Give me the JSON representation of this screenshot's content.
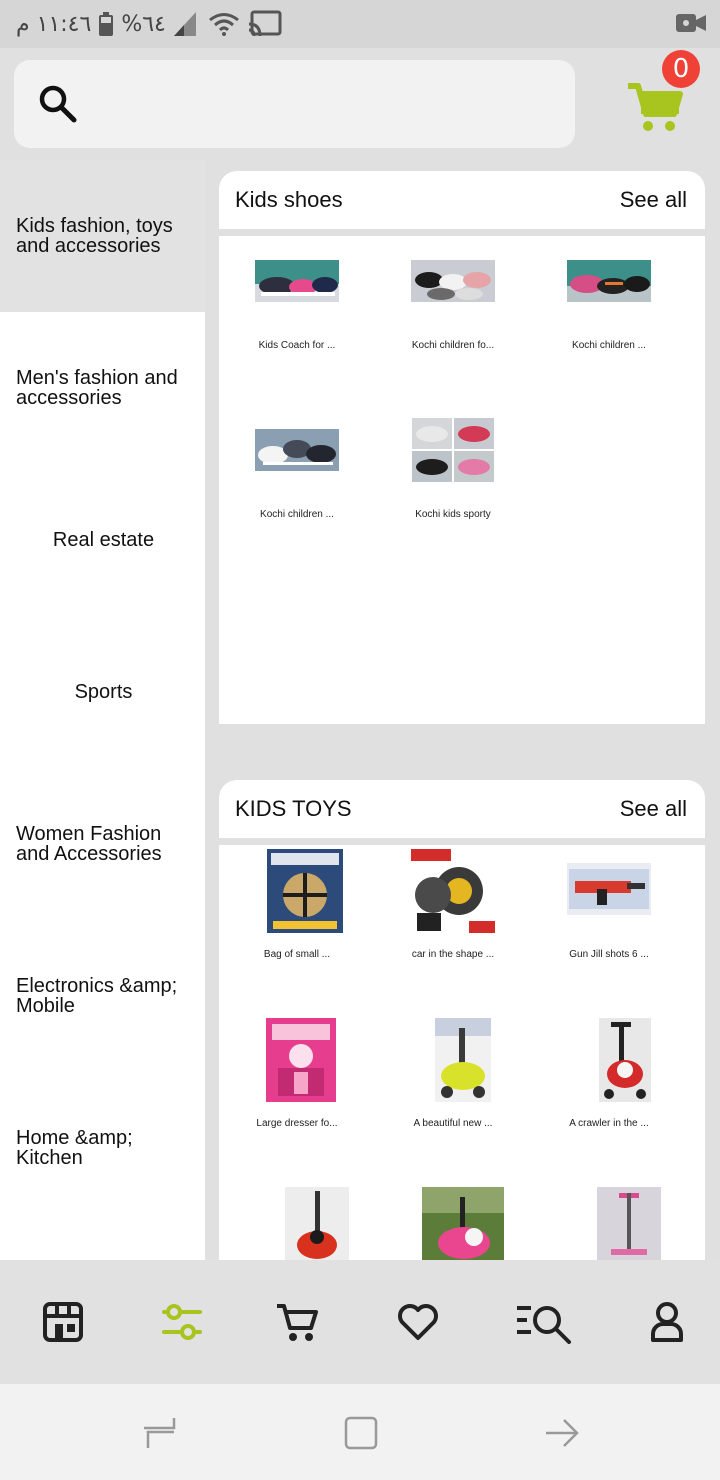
{
  "status_bar": {
    "time": "١١:٤٦ م",
    "battery": "%٦٤",
    "icons": [
      "battery-icon",
      "signal-icon",
      "wifi-icon",
      "cast-icon",
      "video-camera-icon"
    ]
  },
  "header": {
    "search_placeholder": "",
    "cart_count": "0",
    "accent_color": "#a8c41e",
    "badge_color": "#ef4136"
  },
  "sidebar": {
    "categories": [
      {
        "label": "Kids fashion, toys and accessories",
        "active": true
      },
      {
        "label": "Men's fashion and accessories"
      },
      {
        "label": "Real estate"
      },
      {
        "label": "Sports"
      },
      {
        "label": "Women Fashion and Accessories"
      },
      {
        "label": "Electronics &amp; Mobile"
      },
      {
        "label": "Home &amp; Kitchen"
      }
    ]
  },
  "sections": [
    {
      "title": "Kids shoes",
      "see_all": "See all",
      "products": [
        {
          "caption": "Kids Coach for ..."
        },
        {
          "caption": "Kochi children fo..."
        },
        {
          "caption": "Kochi children ..."
        },
        {
          "caption": "Kochi children ..."
        },
        {
          "caption": "Kochi kids sporty"
        }
      ]
    },
    {
      "title": "KIDS TOYS",
      "see_all": "See all",
      "products": [
        {
          "caption": "Bag of small ..."
        },
        {
          "caption": "car in the shape ..."
        },
        {
          "caption": "Gun Jill shots 6 ..."
        },
        {
          "caption": "Large dresser fo..."
        },
        {
          "caption": "A beautiful new ..."
        },
        {
          "caption": "A crawler in the ..."
        },
        {
          "caption": ""
        },
        {
          "caption": ""
        },
        {
          "caption": ""
        }
      ]
    }
  ],
  "bottom_nav": {
    "items": [
      "store-icon",
      "filter-sliders-icon",
      "cart-icon",
      "heart-icon",
      "search-list-icon",
      "user-icon"
    ],
    "active": "filter-sliders-icon"
  },
  "system_nav": [
    "recent-apps-icon",
    "home-icon",
    "back-icon"
  ]
}
